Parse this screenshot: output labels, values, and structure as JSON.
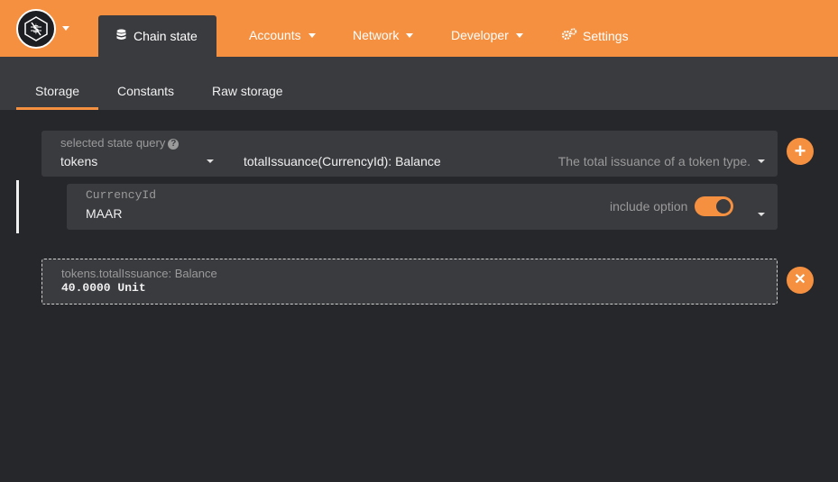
{
  "nav": {
    "active_label": "Chain state",
    "items": [
      {
        "label": "Accounts",
        "has_caret": true
      },
      {
        "label": "Network",
        "has_caret": true
      },
      {
        "label": "Developer",
        "has_caret": true
      },
      {
        "label": "Settings",
        "has_caret": false,
        "icon": "gears-icon"
      }
    ]
  },
  "subtabs": [
    {
      "label": "Storage",
      "active": true
    },
    {
      "label": "Constants",
      "active": false
    },
    {
      "label": "Raw storage",
      "active": false
    }
  ],
  "query": {
    "label": "selected state query",
    "section": "tokens",
    "method": "totalIssuance(CurrencyId): Balance",
    "description": "The total issuance of a token type."
  },
  "param": {
    "label": "CurrencyId",
    "value": "MAAR",
    "include_option_label": "include option",
    "include_option_on": true
  },
  "result": {
    "label": "tokens.totalIssuance: Balance",
    "value": "40.0000 Unit"
  },
  "colors": {
    "accent": "#f59040",
    "background": "#26272b",
    "panel": "#3a3b3f"
  }
}
